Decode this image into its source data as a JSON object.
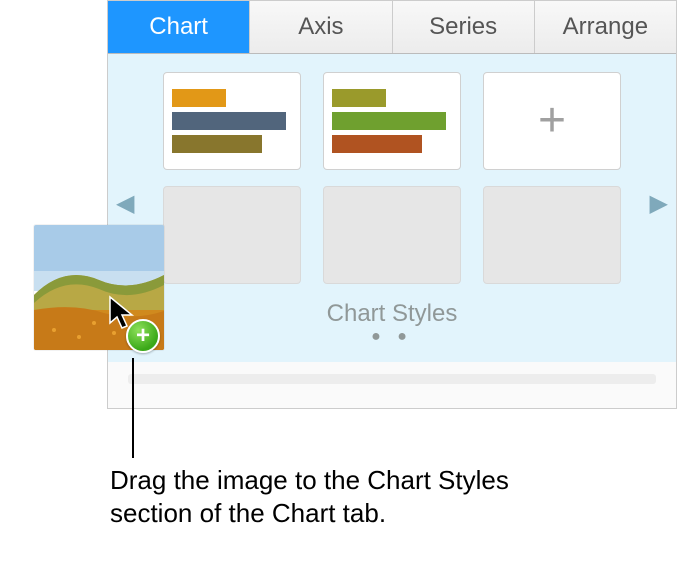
{
  "tabs": {
    "chart": "Chart",
    "axis": "Axis",
    "series": "Series",
    "arrange": "Arrange"
  },
  "styles": {
    "section_label": "Chart Styles",
    "add_label": "+",
    "pager": "● ●"
  },
  "cursor": {
    "plus": "+"
  },
  "callout": {
    "text": "Drag the image to the Chart Styles section of the Chart tab."
  }
}
